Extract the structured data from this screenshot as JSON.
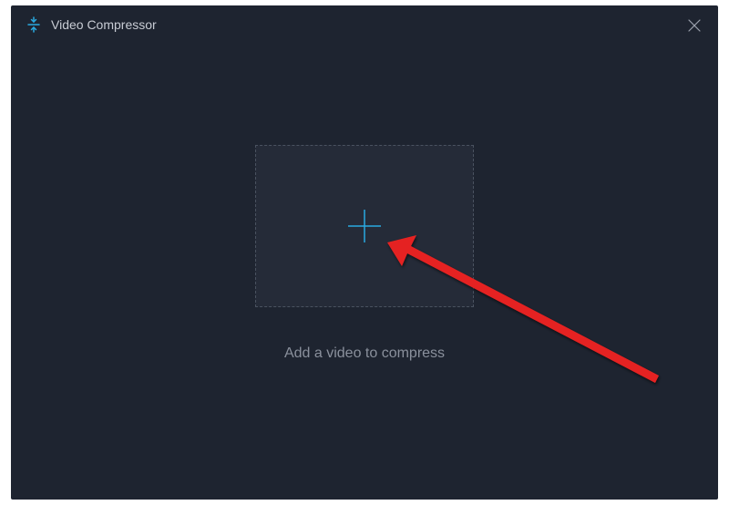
{
  "header": {
    "title": "Video Compressor"
  },
  "main": {
    "instruction": "Add a video to compress"
  },
  "colors": {
    "accent": "#2aa9e0",
    "arrow": "#e52421"
  }
}
